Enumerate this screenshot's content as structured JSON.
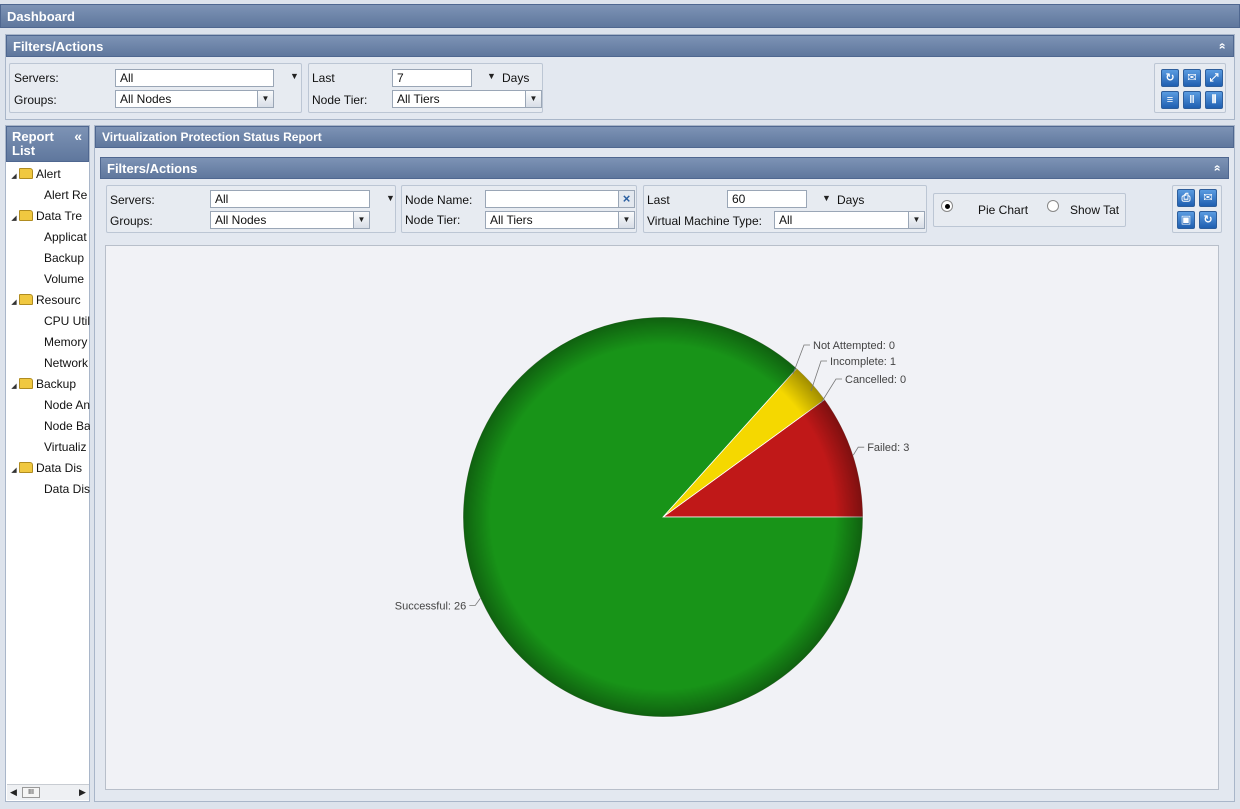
{
  "app": {
    "title": "Dashboard"
  },
  "top_filters": {
    "title": "Filters/Actions",
    "collapse_glyph": "»",
    "servers_label": "Servers:",
    "servers_value": "All",
    "groups_label": "Groups:",
    "groups_value": "All Nodes",
    "last_label": "Last",
    "last_value": "7",
    "days_label": "Days",
    "node_tier_label": "Node Tier:",
    "node_tier_value": "All Tiers",
    "icons": [
      "refresh-icon",
      "email-icon",
      "export-icon",
      "layout-single-icon",
      "layout-two-column-icon",
      "layout-three-column-icon"
    ]
  },
  "sidebar": {
    "title_line1": "Report",
    "title_line2": "List",
    "collapse_glyph": "«",
    "items": [
      {
        "label": "Alert",
        "folder": true
      },
      {
        "label": "Alert Re",
        "folder": false
      },
      {
        "label": "Data Tre",
        "folder": true
      },
      {
        "label": "Applicat",
        "folder": false
      },
      {
        "label": "Backup",
        "folder": false
      },
      {
        "label": "Volume",
        "folder": false
      },
      {
        "label": "Resourc",
        "folder": true
      },
      {
        "label": "CPU Util",
        "folder": false
      },
      {
        "label": "Memory",
        "folder": false
      },
      {
        "label": "Network",
        "folder": false
      },
      {
        "label": "Backup",
        "folder": true
      },
      {
        "label": "Node An",
        "folder": false
      },
      {
        "label": "Node Ba",
        "folder": false
      },
      {
        "label": "Virtualiz",
        "folder": false
      },
      {
        "label": "Data Dis",
        "folder": true
      },
      {
        "label": "Data Dis",
        "folder": false
      }
    ],
    "scroll_thumb_glyph": "III"
  },
  "report": {
    "title": "Virtualization Protection Status Report",
    "filters_title": "Filters/Actions",
    "collapse_glyph": "»",
    "servers_label": "Servers:",
    "servers_value": "All",
    "groups_label": "Groups:",
    "groups_value": "All Nodes",
    "node_name_label": "Node Name:",
    "node_name_value": "",
    "clear_glyph": "×",
    "node_tier_label": "Node Tier:",
    "node_tier_value": "All Tiers",
    "last_label": "Last",
    "last_value": "60",
    "days_label": "Days",
    "vm_type_label": "Virtual Machine Type:",
    "vm_type_value": "All",
    "pie_chart_label": "Pie Chart",
    "show_table_label": "Show Tat",
    "pie_selected": true,
    "icons": [
      "print-icon",
      "email-icon",
      "save-icon",
      "refresh-icon"
    ]
  },
  "chart_data": {
    "type": "pie",
    "title": "",
    "slices": [
      {
        "label": "Failed",
        "value": 3,
        "color": "#c01818",
        "text": "Failed: 3"
      },
      {
        "label": "Cancelled",
        "value": 0,
        "color": "#d8d8d8",
        "text": "Cancelled: 0"
      },
      {
        "label": "Incomplete",
        "value": 1,
        "color": "#f5d800",
        "text": "Incomplete: 1"
      },
      {
        "label": "Not Attempted",
        "value": 0,
        "color": "#8080ff",
        "text": "Not Attempted: 0"
      },
      {
        "label": "Successful",
        "value": 26,
        "color": "#189418",
        "text": "Successful: 26"
      }
    ]
  }
}
